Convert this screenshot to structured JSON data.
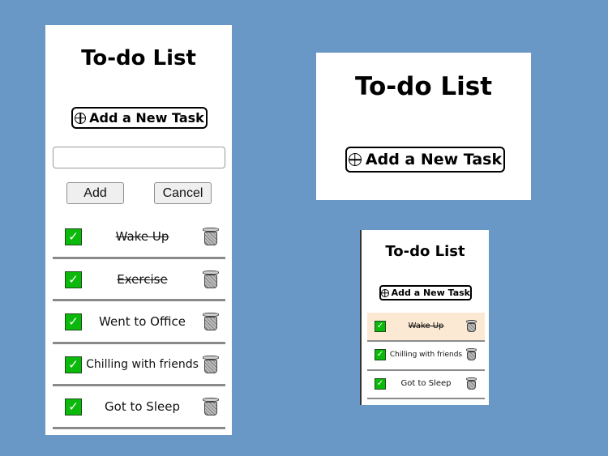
{
  "panel_full": {
    "title": "To-do List",
    "add_task_label": "Add a New Task",
    "input": {
      "value": "",
      "placeholder": ""
    },
    "add_button_label": "Add",
    "cancel_button_label": "Cancel",
    "tasks": [
      {
        "label": "Wake Up",
        "done": true,
        "checked": true
      },
      {
        "label": "Exercise",
        "done": true,
        "checked": true
      },
      {
        "label": "Went to Office",
        "done": false,
        "checked": true
      },
      {
        "label": "Chilling with friends",
        "done": false,
        "checked": true
      },
      {
        "label": "Got to Sleep",
        "done": false,
        "checked": true
      }
    ]
  },
  "panel_empty": {
    "title": "To-do List",
    "add_task_label": "Add a New Task"
  },
  "panel_small": {
    "title": "To-do List",
    "add_task_label": "Add a New Task",
    "tasks": [
      {
        "label": "Wake Up",
        "done": true,
        "checked": true,
        "highlighted": true
      },
      {
        "label": "Chilling with friends",
        "done": false,
        "checked": true
      },
      {
        "label": "Got to Sleep",
        "done": false,
        "checked": true
      }
    ]
  },
  "colors": {
    "background": "#6a98c6",
    "card": "#ffffff",
    "checkbox": "#0bb90b",
    "highlight_row": "#fbe9d4",
    "divider": "#8a8a8a"
  },
  "icons": {
    "add": "circle-plus-icon",
    "check": "checkmark-icon",
    "delete": "trash-icon"
  }
}
